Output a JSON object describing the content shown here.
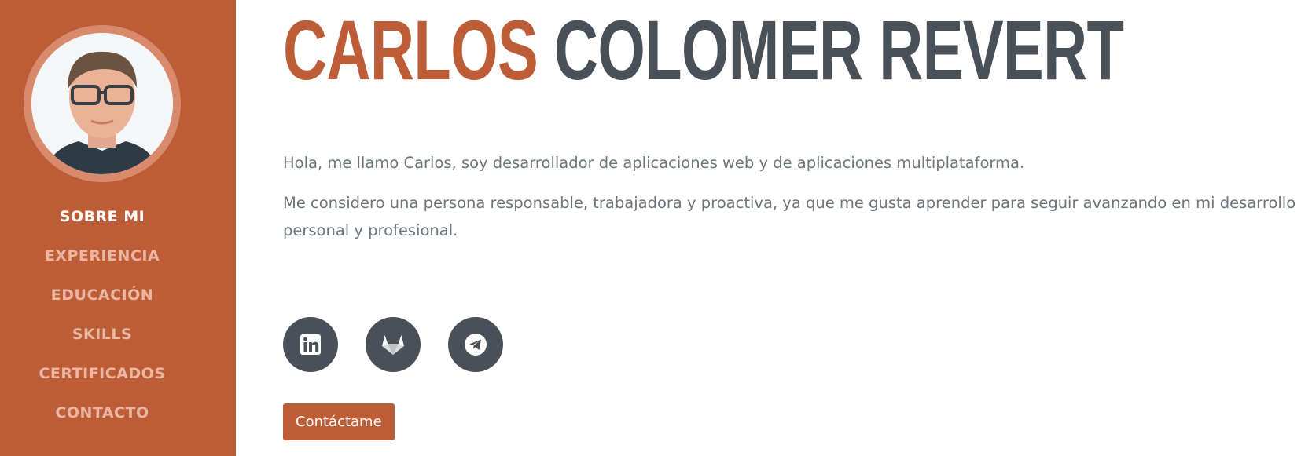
{
  "profile": {
    "avatar_alt": "Carlos Colomer Revert"
  },
  "header": {
    "first_name": "CARLOS",
    "last_name": "COLOMER REVERT"
  },
  "nav": {
    "items": [
      {
        "label": "SOBRE MI",
        "active": true
      },
      {
        "label": "EXPERIENCIA"
      },
      {
        "label": "EDUCACIÓN"
      },
      {
        "label": "SKILLS"
      },
      {
        "label": "CERTIFICADOS"
      },
      {
        "label": "CONTACTO"
      }
    ]
  },
  "intro": {
    "paragraphs": [
      "Hola, me llamo Carlos, soy desarrollador de aplicaciones web y de aplicaciones multiplataforma.",
      "Me considero una persona responsable, trabajadora y proactiva, ya que me gusta aprender para seguir avanzando en mi desarrollo personal y profesional."
    ]
  },
  "social": {
    "items": [
      {
        "icon": "linkedin-icon"
      },
      {
        "icon": "gitlab-icon"
      },
      {
        "icon": "telegram-icon"
      }
    ]
  },
  "contact_button": {
    "label": "Contáctame"
  },
  "colors": {
    "accent": "#bd5d38",
    "dark": "#495057",
    "text": "#6c757d",
    "nav_inactive": "#ebb6a2"
  }
}
